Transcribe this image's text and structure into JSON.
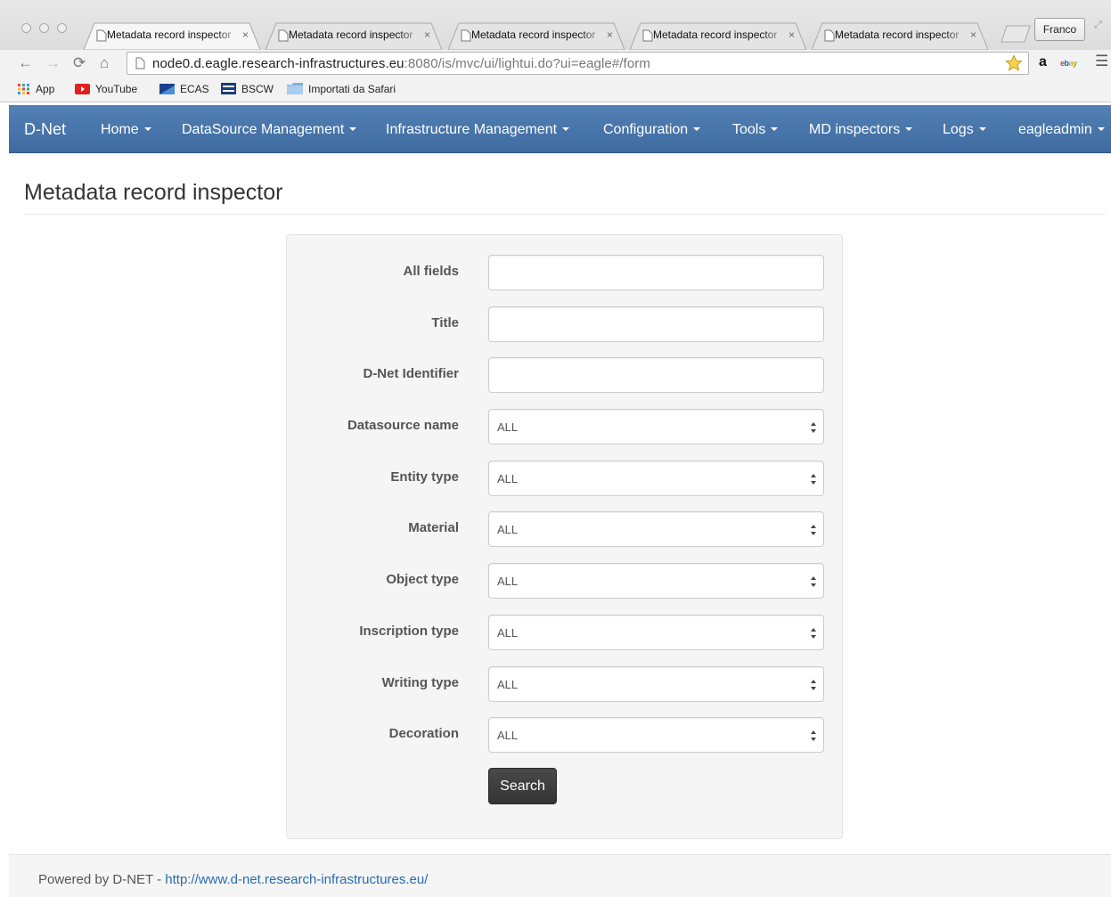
{
  "browser": {
    "tabs": [
      {
        "title": "Metadata record inspector"
      },
      {
        "title": "Metadata record inspector"
      },
      {
        "title": "Metadata record inspector"
      },
      {
        "title": "Metadata record inspector"
      },
      {
        "title": "Metadata record inspector"
      }
    ],
    "tab_close_glyph": "×",
    "user_name": "Franco",
    "url_host": "node0.d.eagle.research-infrastructures.eu",
    "url_rest": ":8080/is/mvc/ui/lightui.do?ui=eagle#/form",
    "bookmarks": [
      "App",
      "YouTube",
      "ECAS",
      "BSCW",
      "Importati da Safari"
    ],
    "extensions": {
      "amazon": "a",
      "ebay": "ebay"
    }
  },
  "navbar": {
    "brand": "D-Net",
    "items": [
      "Home",
      "DataSource Management",
      "Infrastructure Management",
      "Configuration",
      "Tools",
      "MD inspectors",
      "Logs",
      "eagleadmin"
    ]
  },
  "page": {
    "title": "Metadata record inspector"
  },
  "form": {
    "text_fields": [
      {
        "label": "All fields",
        "value": ""
      },
      {
        "label": "Title",
        "value": ""
      },
      {
        "label": "D-Net Identifier",
        "value": ""
      }
    ],
    "select_fields": [
      {
        "label": "Datasource name",
        "value": "ALL"
      },
      {
        "label": "Entity type",
        "value": "ALL"
      },
      {
        "label": "Material",
        "value": "ALL"
      },
      {
        "label": "Object type",
        "value": "ALL"
      },
      {
        "label": "Inscription type",
        "value": "ALL"
      },
      {
        "label": "Writing type",
        "value": "ALL"
      },
      {
        "label": "Decoration",
        "value": "ALL"
      }
    ],
    "search_label": "Search"
  },
  "footer": {
    "text": "Powered by D-NET - ",
    "link": "http://www.d-net.research-infrastructures.eu/"
  },
  "colors": {
    "navbar": "#4a76aa",
    "link": "#2a6bb0",
    "button": "#3c3c3c"
  }
}
